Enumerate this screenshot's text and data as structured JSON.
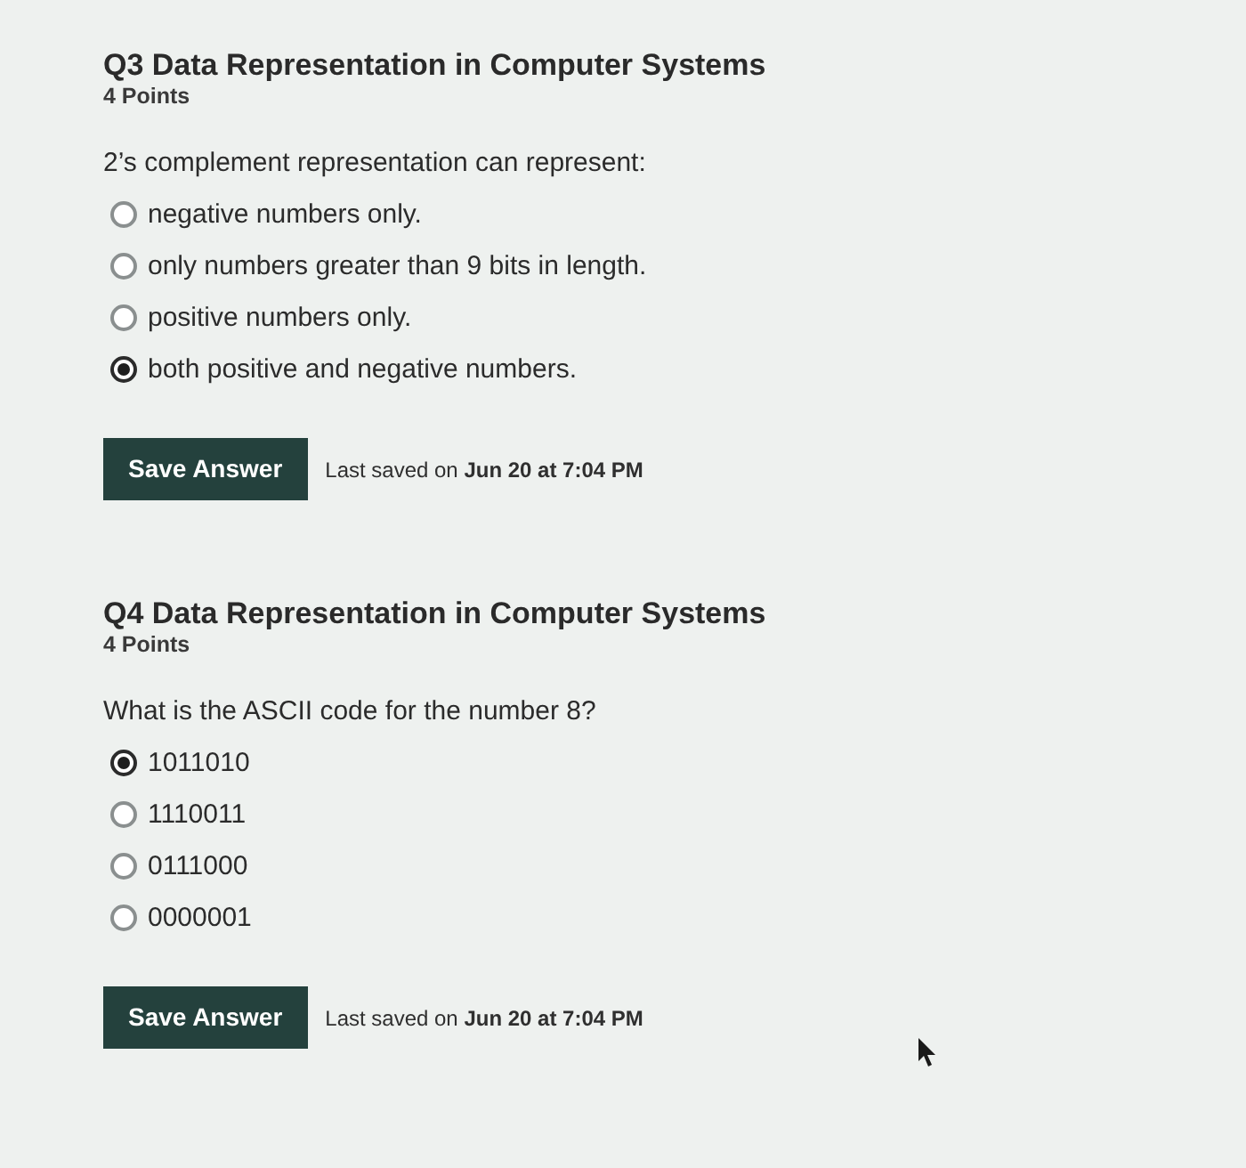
{
  "questions": [
    {
      "title": "Q3 Data Representation in Computer Systems",
      "points": "4 Points",
      "prompt": "2’s complement representation can represent:",
      "options": [
        {
          "label": "negative numbers only.",
          "selected": false
        },
        {
          "label": "only numbers greater than 9 bits in length.",
          "selected": false
        },
        {
          "label": "positive numbers only.",
          "selected": false
        },
        {
          "label": "both positive and negative numbers.",
          "selected": true
        }
      ],
      "save_button": "Save Answer",
      "last_saved": "Last saved on **Jun 20 at 7:04 PM**"
    },
    {
      "title": "Q4 Data Representation in Computer Systems",
      "points": "4 Points",
      "prompt": "What is the ASCII code for the number 8?",
      "options": [
        {
          "label": "1011010",
          "selected": true
        },
        {
          "label": "1110011",
          "selected": false
        },
        {
          "label": "0111000",
          "selected": false
        },
        {
          "label": "0000001",
          "selected": false
        }
      ],
      "save_button": "Save Answer",
      "last_saved": "Last saved on **Jun 20 at 7:04 PM**"
    }
  ]
}
